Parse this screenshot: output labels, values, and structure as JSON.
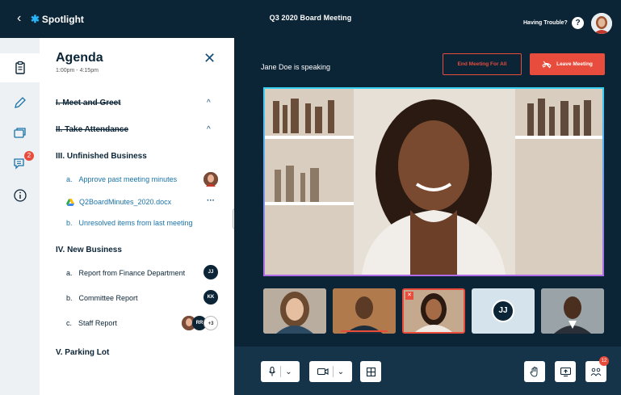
{
  "header": {
    "back_icon": "chevron-left-icon",
    "app_name": "Spotlight",
    "meeting_title": "Q3 2020 Board Meeting",
    "having_trouble": "Having Trouble?",
    "help_symbol": "?"
  },
  "rail": {
    "items": [
      {
        "icon": "clipboard-icon",
        "active": true
      },
      {
        "icon": "pencil-icon"
      },
      {
        "icon": "folders-icon"
      },
      {
        "icon": "chat-icon",
        "badge": "2"
      },
      {
        "icon": "info-icon"
      }
    ]
  },
  "agenda": {
    "title": "Agenda",
    "time": "1:00pm - 4:15pm",
    "close_symbol": "✕",
    "sections": [
      {
        "label": "I. Meet and Greet",
        "completed": true
      },
      {
        "label": "II. Take Attendance",
        "completed": true
      },
      {
        "label": "III. Unfinished Business"
      },
      {
        "label": "IV. New Business"
      },
      {
        "label": "V. Parking Lot"
      }
    ],
    "items": [
      {
        "num": "a.",
        "label": "Approve past meeting minutes"
      },
      {
        "label": "Q2BoardMinutes_2020.docx"
      },
      {
        "num": "b.",
        "label": "Unresolved items from last meeting"
      },
      {
        "num": "a.",
        "label": "Report from Finance Department",
        "assignee": "JJ"
      },
      {
        "num": "b.",
        "label": "Committee Report",
        "assignee": "KK"
      },
      {
        "num": "c.",
        "label": "Staff Report",
        "assignee": "RR",
        "extra": "+3"
      }
    ],
    "more_symbol": "···",
    "chevron_up": "^"
  },
  "meeting": {
    "speaking": "Jane Doe is speaking",
    "end_all": "End Meeting For All",
    "leave": "Leave Meeting",
    "thumb_initials": "JJ"
  },
  "controls": {
    "participants_badge": "12"
  },
  "colors": {
    "navy": "#0b2436",
    "accent_red": "#e74c3c",
    "link_blue": "#1a73a8",
    "speaker_border_top": "#38d0f0",
    "speaker_border_bottom": "#b06ce8"
  }
}
